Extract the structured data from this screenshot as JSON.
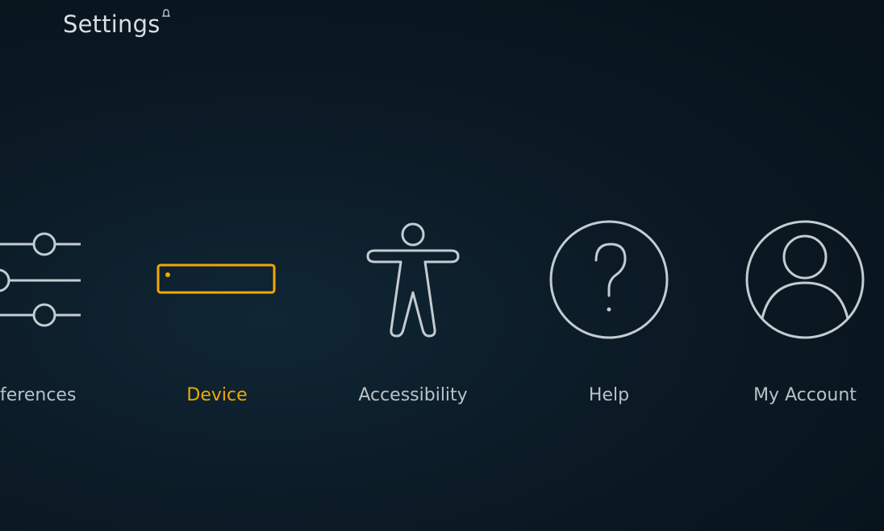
{
  "header": {
    "title": "Settings"
  },
  "items": [
    {
      "label": "ferences",
      "icon": "sliders-icon",
      "selected": false
    },
    {
      "label": "Device",
      "icon": "device-icon",
      "selected": true
    },
    {
      "label": "Accessibility",
      "icon": "accessibility-icon",
      "selected": false
    },
    {
      "label": "Help",
      "icon": "help-icon",
      "selected": false
    },
    {
      "label": "My Account",
      "icon": "account-icon",
      "selected": false
    }
  ],
  "colors": {
    "accent": "#f2a900",
    "icon": "#c4ccd1",
    "background": "#0b1a25"
  }
}
